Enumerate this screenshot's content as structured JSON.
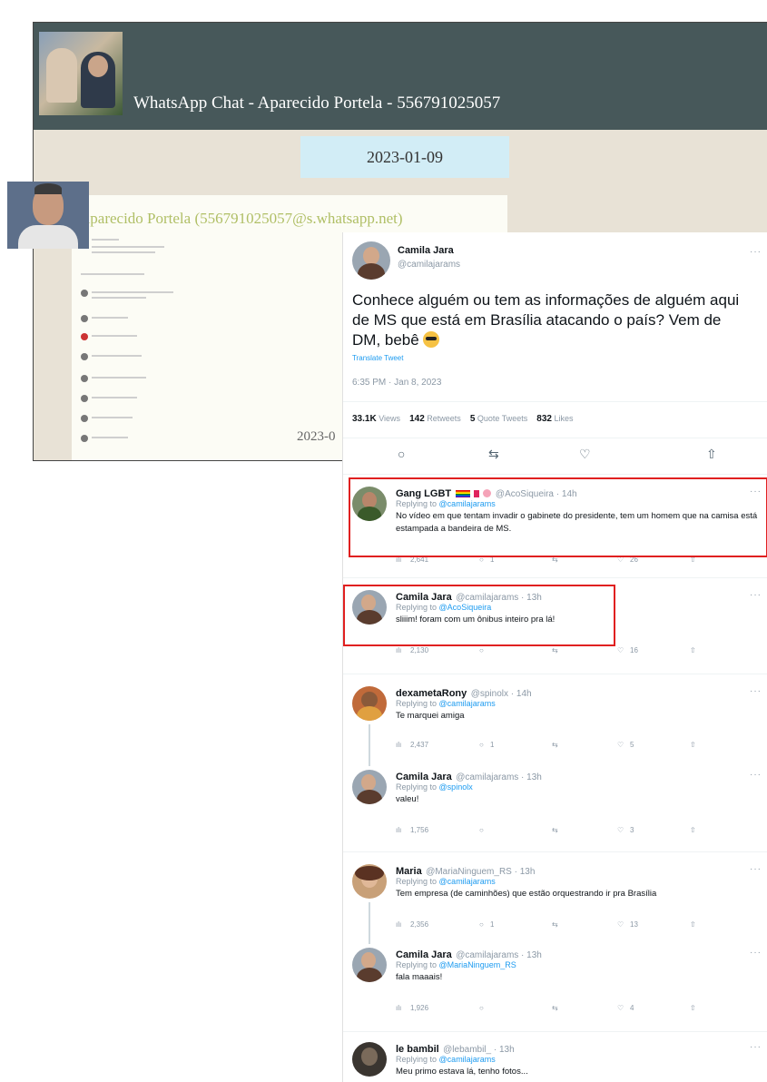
{
  "whatsapp": {
    "title": "WhatsApp Chat - Aparecido Portela - 556791025057",
    "date_badge": "2023-01-09",
    "sender": "Aparecido Portela (556791025057@s.whatsapp.net)",
    "time_partial": "2023-0"
  },
  "tweet": {
    "author_name": "Camila Jara",
    "author_handle": "@camilajarams",
    "text": "Conhece alguém ou tem as informações de alguém aqui de MS que está em Brasília atacando o país? Vem de DM, bebê",
    "translate": "Translate Tweet",
    "datetime": "6:35 PM · Jan 8, 2023",
    "views_value": "33.1K",
    "views_label": "Views",
    "retweets_value": "142",
    "retweets_label": "Retweets",
    "quotes_value": "5",
    "quotes_label": "Quote Tweets",
    "likes_value": "832",
    "likes_label": "Likes",
    "more": "···"
  },
  "icons": {
    "reply": "○",
    "retweet": "⇆",
    "like": "♡",
    "share": "⇧",
    "views": "ılı"
  },
  "replies": [
    {
      "name": "Gang LGBT",
      "handle": "@AcoSiqueira · 14h",
      "replying_prefix": "Replying to",
      "replying_to": "@camilajarams",
      "text": "No vídeo em que tentam invadir o gabinete do presidente, tem um homem que na camisa está estampada a bandeira de MS.",
      "views": "2,641",
      "replies": "1",
      "likes": "26"
    },
    {
      "name": "Camila Jara",
      "handle": "@camilajarams · 13h",
      "replying_prefix": "Replying to",
      "replying_to": "@AcoSiqueira",
      "text": "sliiim! foram com um ônibus inteiro pra lá!",
      "views": "2,130",
      "replies": "",
      "likes": "16"
    },
    {
      "name": "dexametaRony",
      "handle": "@spinolx · 14h",
      "replying_prefix": "Replying to",
      "replying_to": "@camilajarams",
      "text": "Te marquei amiga",
      "views": "2,437",
      "replies": "1",
      "likes": "5"
    },
    {
      "name": "Camila Jara",
      "handle": "@camilajarams · 13h",
      "replying_prefix": "Replying to",
      "replying_to": "@spinolx",
      "text": "valeu!",
      "views": "1,756",
      "replies": "",
      "likes": "3"
    },
    {
      "name": "Maria",
      "handle": "@MariaNinguem_RS · 13h",
      "replying_prefix": "Replying to",
      "replying_to": "@camilajarams",
      "text": "Tem empresa (de caminhões) que estão orquestrando ir pra Brasília",
      "views": "2,356",
      "replies": "1",
      "likes": "13"
    },
    {
      "name": "Camila Jara",
      "handle": "@camilajarams · 13h",
      "replying_prefix": "Replying to",
      "replying_to": "@MariaNinguem_RS",
      "text": "fala maaais!",
      "views": "1,926",
      "replies": "",
      "likes": "4"
    },
    {
      "name": "le bambil",
      "handle": "@lebambil_ · 13h",
      "replying_prefix": "Replying to",
      "replying_to": "@camilajarams",
      "text": "Meu primo estava lá, tenho fotos...",
      "views": "",
      "replies": "",
      "likes": ""
    }
  ]
}
